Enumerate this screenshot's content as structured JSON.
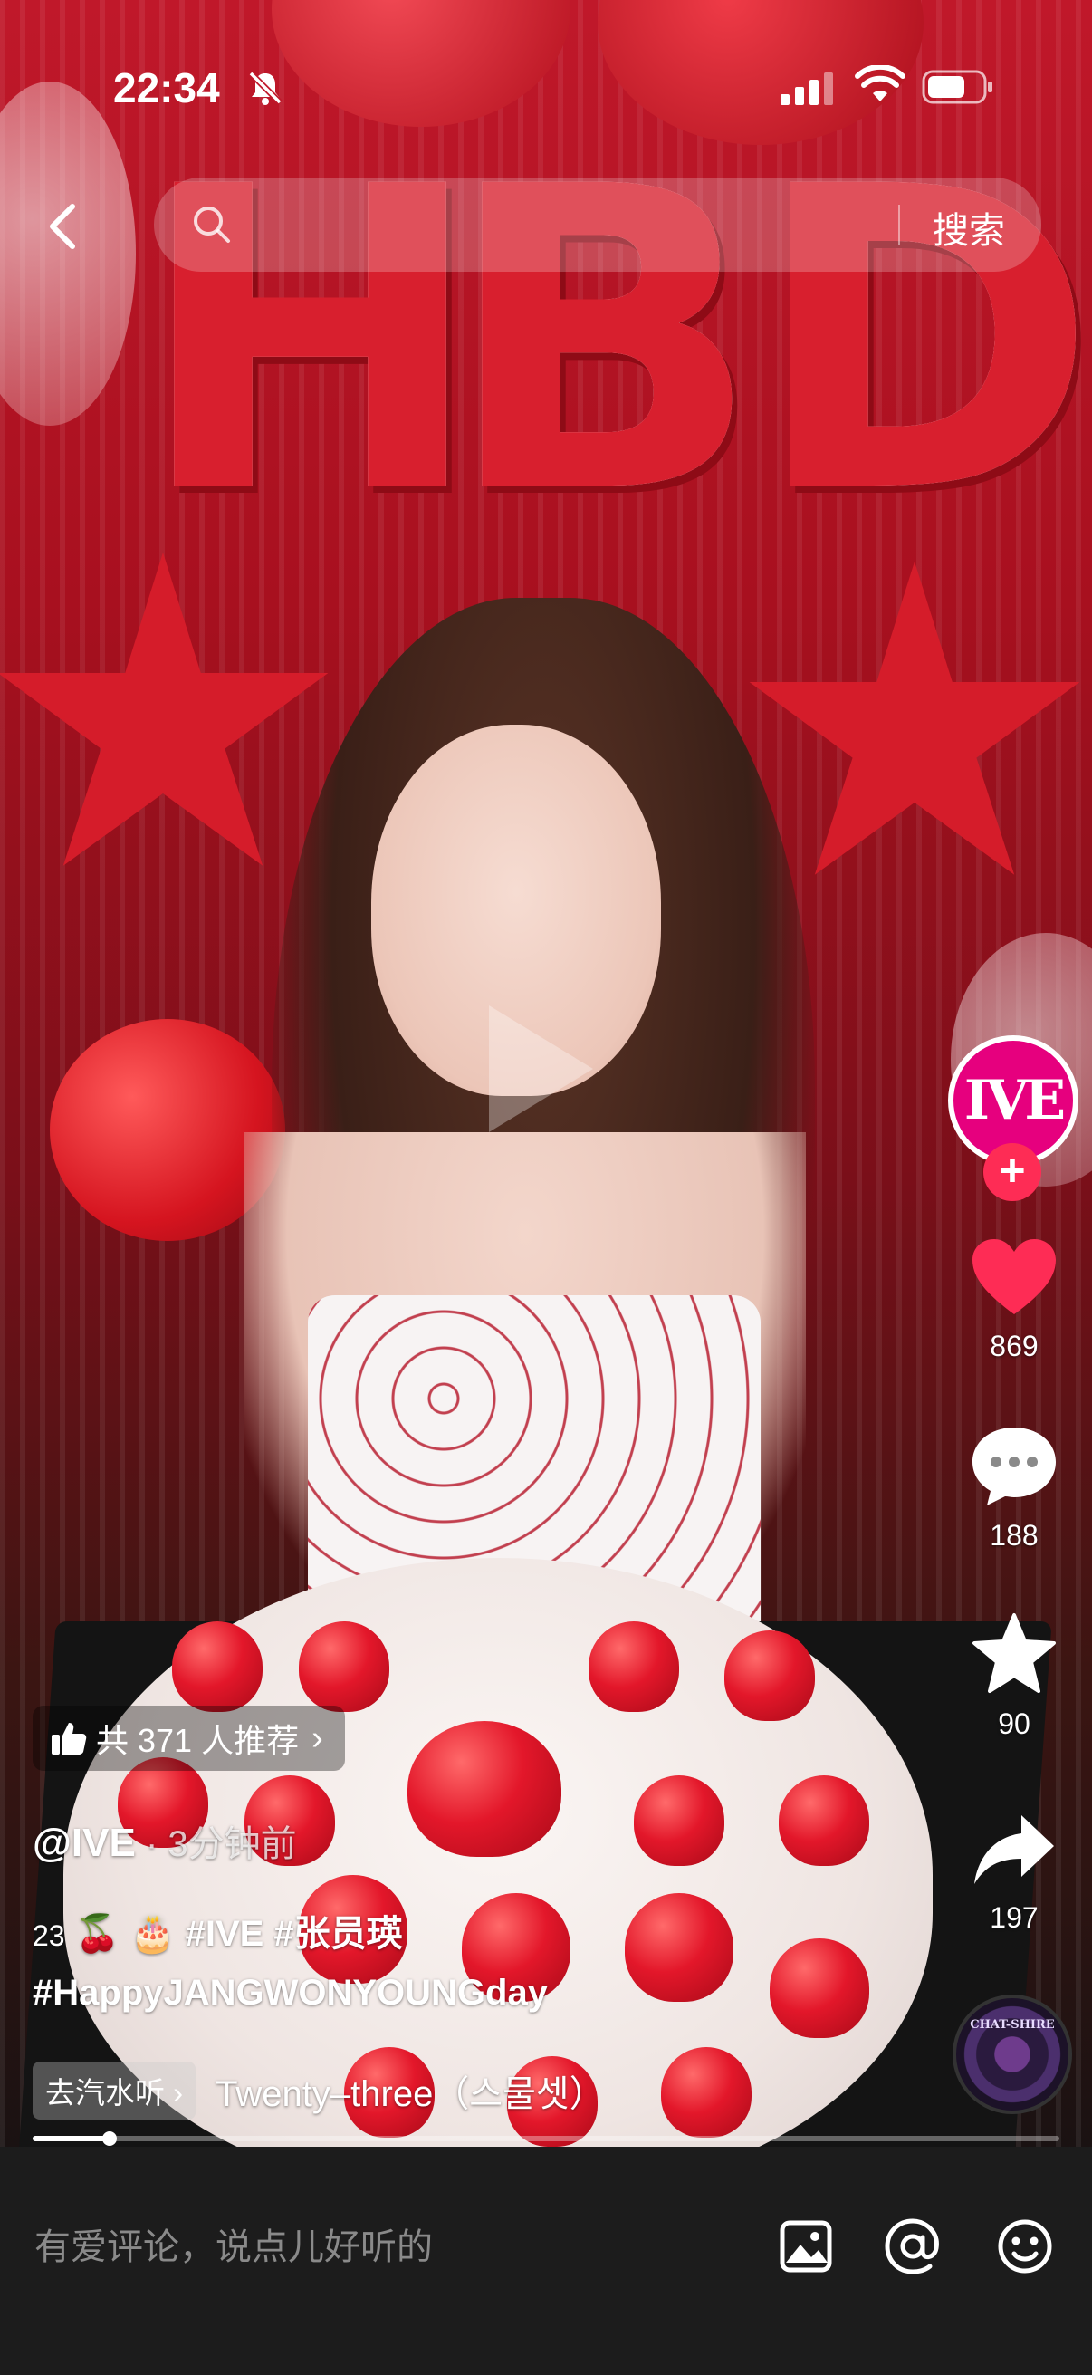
{
  "status_bar": {
    "time": "22:34",
    "icons": [
      "mute-bell-icon",
      "signal-icon",
      "wifi-icon",
      "battery-icon"
    ]
  },
  "search": {
    "placeholder": "",
    "button_label": "搜索",
    "icons": [
      "back-chevron-icon",
      "search-icon"
    ]
  },
  "video": {
    "backdrop_letters": [
      "H",
      "B",
      "D"
    ],
    "accent_colors": {
      "backdrop_red": "#c0182a",
      "like_red": "#fe2c55",
      "avatar_pink": "#e6007e"
    }
  },
  "actions": {
    "avatar_label": "IVE",
    "follow_symbol": "+",
    "like_count": "869",
    "comment_count": "188",
    "favorite_count": "90",
    "share_count": "197",
    "music_disc_label": "CHAT-SHIRE"
  },
  "caption": {
    "recommend": "共 371 人推荐",
    "recommend_chevron": "›",
    "author": "@IVE",
    "separator": " · ",
    "time_ago": "3分钟前",
    "line1_number": "23",
    "line1_emoji": "🍒 🎂",
    "line1_tags": "#IVE #张员瑛",
    "line2_tags": "#HappyJANGWONYOUNGday",
    "music_chip": "去汽水听 ›",
    "music_title": "Twenty–three（스물셋）"
  },
  "progress": {
    "fraction": 0.075
  },
  "comment_bar": {
    "placeholder": "有爱评论，说点儿好听的",
    "icons": [
      "image-icon",
      "at-mention-icon",
      "emoji-icon"
    ]
  }
}
